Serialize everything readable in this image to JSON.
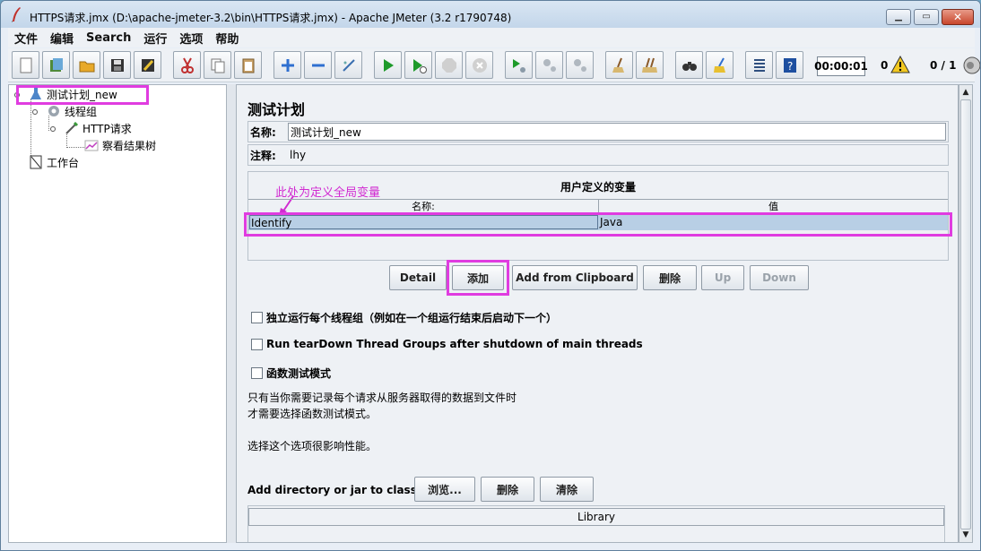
{
  "window": {
    "title": "HTTPS请求.jmx (D:\\apache-jmeter-3.2\\bin\\HTTPS请求.jmx) - Apache JMeter (3.2 r1790748)"
  },
  "menu": [
    "文件",
    "编辑",
    "Search",
    "运行",
    "选项",
    "帮助"
  ],
  "toolbar": {
    "timer": "00:00:01",
    "error_count": "0",
    "threads": "0 / 1"
  },
  "tree": {
    "items": [
      {
        "label": "测试计划_new"
      },
      {
        "label": "线程组"
      },
      {
        "label": "HTTP请求"
      },
      {
        "label": "察看结果树"
      },
      {
        "label": "工作台"
      }
    ]
  },
  "plan": {
    "title": "测试计划",
    "name_label": "名称:",
    "name_value": "测试计划_new",
    "comment_label": "注释:",
    "comment_value": "lhy",
    "udv_title": "用户定义的变量",
    "annotation": "此处为定义全局变量",
    "col_name": "名称:",
    "col_value": "值",
    "rows": [
      {
        "name": "Identify",
        "value": "Java"
      }
    ],
    "buttons": {
      "detail": "Detail",
      "add": "添加",
      "add_clipboard": "Add from Clipboard",
      "delete": "删除",
      "up": "Up",
      "down": "Down"
    },
    "option_independent": "独立运行每个线程组（例如在一个组运行结束后启动下一个）",
    "option_teardown": "Run tearDown Thread Groups after shutdown of main threads",
    "option_functional": "函数测试模式",
    "note_line1": "只有当你需要记录每个请求从服务器取得的数据到文件时",
    "note_line2": "才需要选择函数测试模式。",
    "note_line3": "选择这个选项很影响性能。",
    "classpath_label": "Add directory or jar to classpath",
    "browse": "浏览...",
    "cp_delete": "删除",
    "cp_clear": "清除",
    "library_header": "Library"
  },
  "colors": {
    "highlight": "#e03ce0",
    "annotation": "#d12bd1"
  }
}
